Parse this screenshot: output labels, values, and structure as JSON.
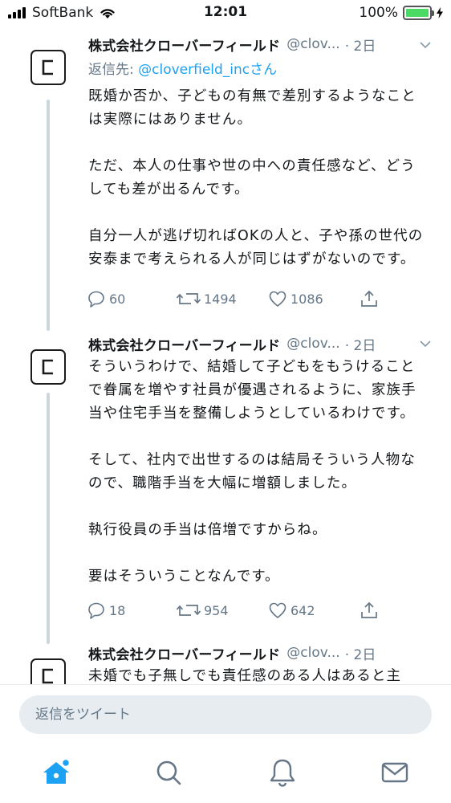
{
  "status_bar": {
    "carrier": "SoftBank",
    "time": "12:01",
    "battery": "100%"
  },
  "tweets": [
    {
      "name": "株式会社クローバーフィールド",
      "handle": "@clov...",
      "time": "· 2日",
      "reply_prefix": "返信先: ",
      "reply_mention": "@cloverfield_incさん",
      "body": "既婚か否か、子どもの有無で差別するようなことは実際にはありません。\n\nただ、本人の仕事や世の中への責任感など、どうしても差が出るんです。\n\n自分一人が逃げ切ればOKの人と、子や孫の世代の安泰まで考えられる人が同じはずがないのです。",
      "replies": "60",
      "retweets": "1494",
      "likes": "1086"
    },
    {
      "name": "株式会社クローバーフィールド",
      "handle": "@clov...",
      "time": "· 2日",
      "body": "そういうわけで、結婚して子どもをもうけることで眷属を増やす社員が優遇されるように、家族手当や住宅手当を整備しようとしているわけです。\n\nそして、社内で出世するのは結局そういう人物なので、職階手当を大幅に増額しました。\n\n執行役員の手当は倍増ですからね。\n\n要はそういうことなんです。",
      "replies": "18",
      "retweets": "954",
      "likes": "642"
    },
    {
      "name": "株式会社クローバーフィールド",
      "handle": "@clov...",
      "time": "· 2日",
      "body": "未婚でも子無しでも責任感のある人はあると主"
    }
  ],
  "reply_box": {
    "placeholder": "返信をツイート"
  },
  "tab_bar": {
    "items": [
      "home-icon",
      "search-icon",
      "notifications-icon",
      "messages-icon"
    ],
    "active_color": "#1da1f2"
  }
}
